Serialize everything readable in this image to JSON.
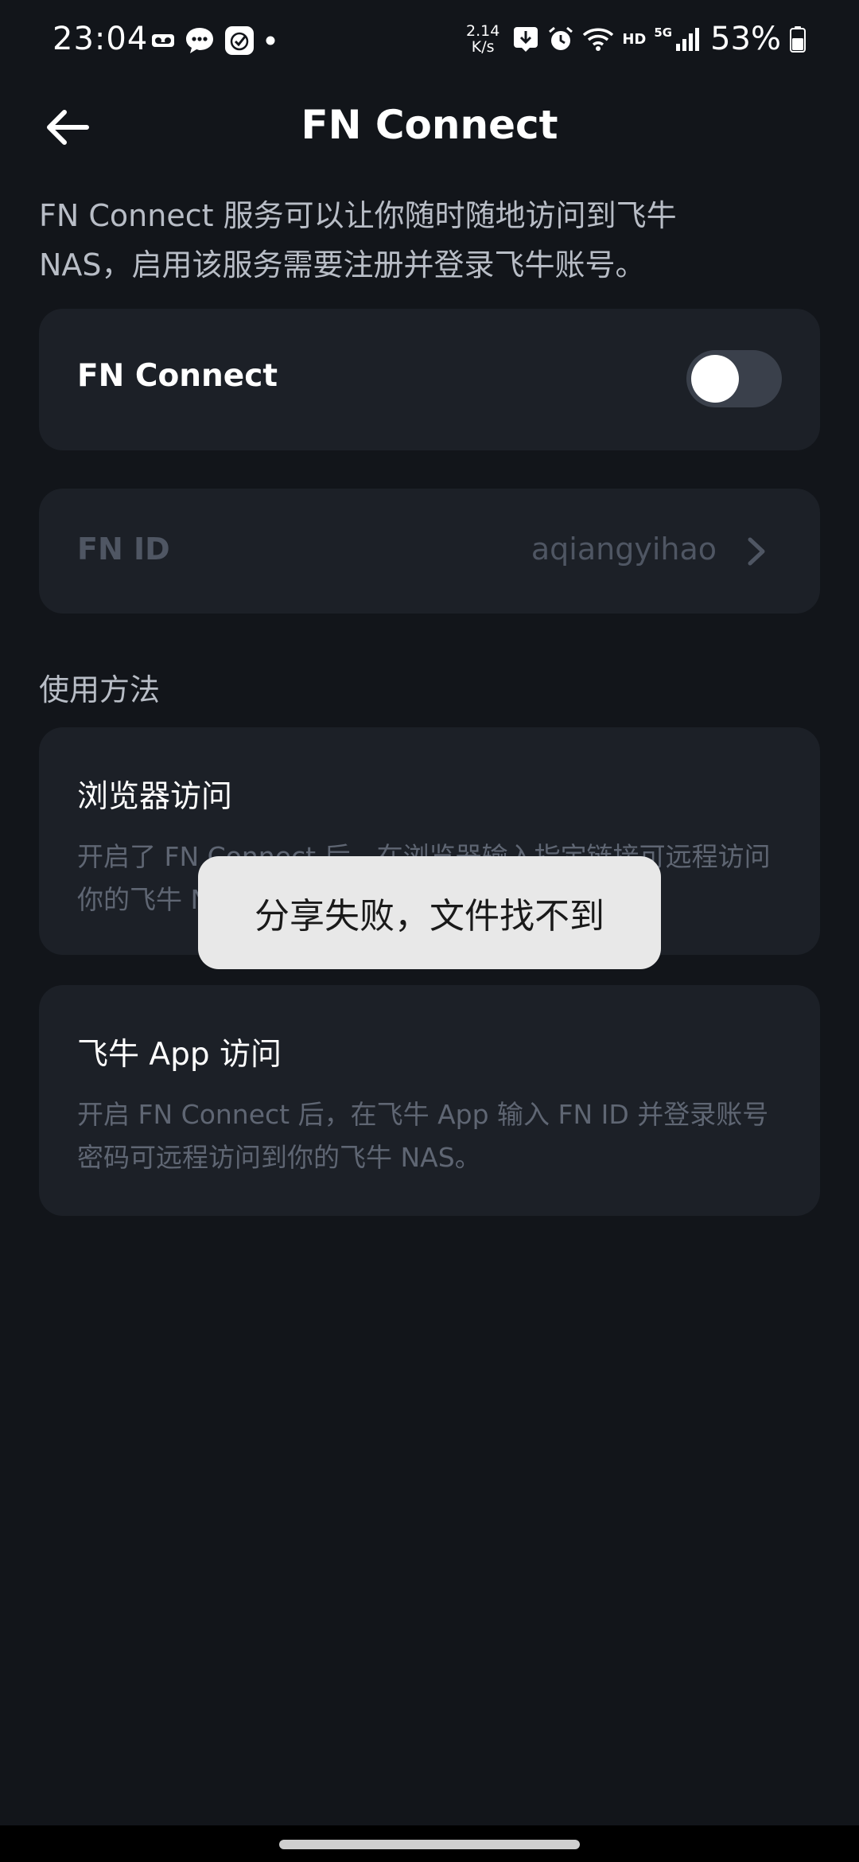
{
  "status_bar": {
    "time": "23:04",
    "speed_value": "2.14",
    "speed_unit": "K/s",
    "hd": "HD",
    "network": "5G",
    "battery": "53%"
  },
  "header": {
    "title": "FN Connect"
  },
  "intro_text": "FN Connect 服务可以让你随时随地访问到飞牛 NAS，启用该服务需要注册并登录飞牛账号。",
  "fn_connect_toggle": {
    "label": "FN Connect",
    "enabled": false
  },
  "fn_id": {
    "label": "FN ID",
    "value": "aqiangyihao"
  },
  "usage": {
    "section_title": "使用方法",
    "browser": {
      "title": "浏览器访问",
      "description": "开启了 FN Connect 后，在浏览器输入指定链接可远程访问你的飞牛 NAS。"
    },
    "app": {
      "title": "飞牛 App 访问",
      "description": "开启 FN Connect 后，在飞牛 App 输入 FN ID 并登录账号密码可远程访问到你的飞牛 NAS。"
    }
  },
  "toast": {
    "message": "分享失败，文件找不到"
  },
  "colors": {
    "background": "#12151a",
    "card": "#1c2027",
    "toast_bg": "#e8e8e8"
  }
}
